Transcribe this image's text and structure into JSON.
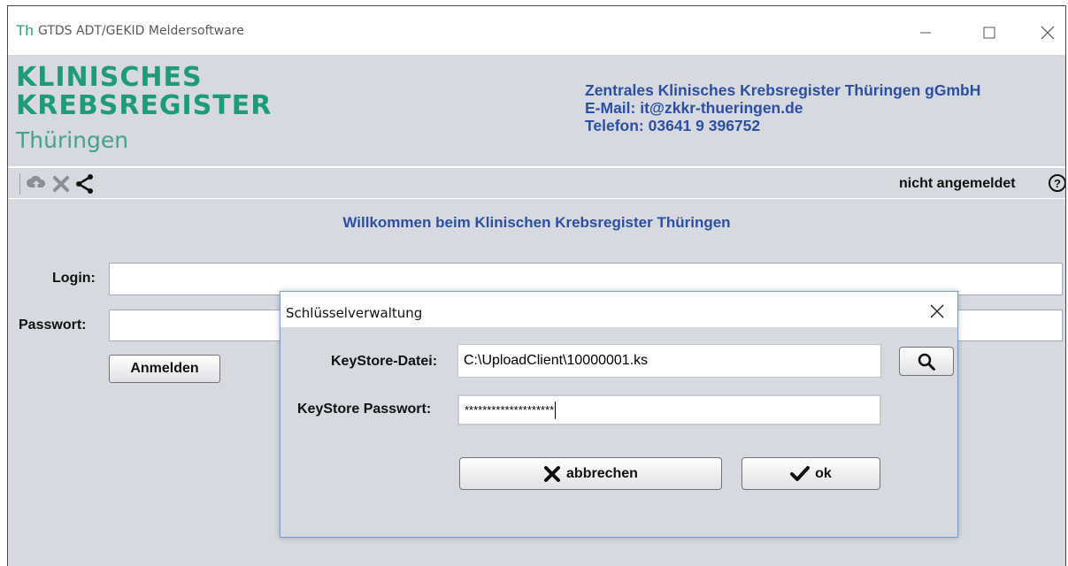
{
  "window": {
    "icon_text": "Th",
    "title": "GTDS ADT/GEKID Meldersoftware"
  },
  "header": {
    "logo_line1": "KLINISCHES",
    "logo_line2": "KREBSREGISTER",
    "logo_line3": "Thüringen",
    "org": "Zentrales Klinisches Krebsregister Thüringen gGmbH",
    "email": "E-Mail:   it@zkkr-thueringen.de",
    "phone": "Telefon: 03641 9 396752"
  },
  "toolbar": {
    "icons": [
      "cloud-upload-icon",
      "close-x-icon",
      "share-icon"
    ],
    "status": "nicht angemeldet",
    "help_icon": "help-icon"
  },
  "main": {
    "welcome": "Willkommen beim Klinischen Krebsregister Thüringen",
    "login_label": "Login:",
    "login_value": "",
    "password_label": "Passwort:",
    "password_value": "",
    "login_button": "Anmelden"
  },
  "dialog": {
    "title": "Schlüsselverwaltung",
    "keystore_file_label": "KeyStore-Datei:",
    "keystore_file_value": "C:\\UploadClient\\10000001.ks",
    "keystore_password_label": "KeyStore Passwort:",
    "keystore_password_value": "********************",
    "cancel_label": "abbrechen",
    "ok_label": "ok"
  },
  "colors": {
    "brand_green": "#1f9b7c",
    "brand_blue": "#2d4fa2",
    "panel_bg": "#d6d9df",
    "dialog_border": "#6aa1d8"
  }
}
